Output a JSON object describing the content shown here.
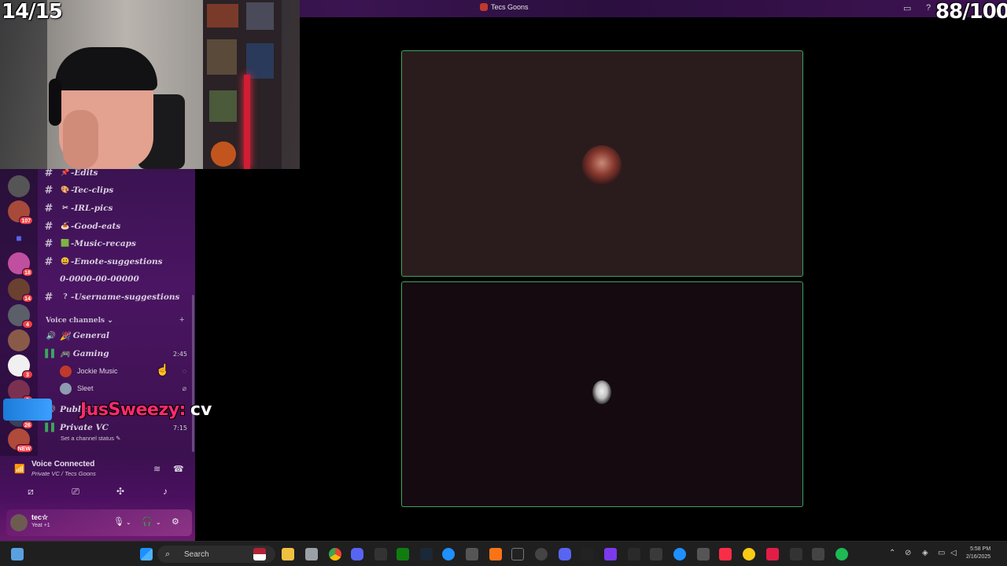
{
  "stream": {
    "left_counter": "14/15",
    "right_counter": "88/100",
    "chat_overlay": {
      "username": "JusSweezy:",
      "message": "cv"
    }
  },
  "window": {
    "title": "Tecs Goons"
  },
  "servers": [
    {
      "icon": "server-avatar",
      "color": "#7a5a48",
      "ping": ""
    },
    {
      "icon": "server-avatar",
      "color": "#a84a3a",
      "ping": "107"
    },
    {
      "icon": "folder-icon",
      "color": "#5865f2",
      "ping": ""
    },
    {
      "icon": "server-avatar",
      "color": "#c04fa0",
      "ping": "18"
    },
    {
      "icon": "server-avatar",
      "color": "#6a4030",
      "ping": "14"
    },
    {
      "icon": "server-avatar",
      "color": "#5a5f6a",
      "ping": "4"
    },
    {
      "icon": "server-avatar",
      "color": "#8a5a48",
      "ping": ""
    },
    {
      "icon": "server-avatar",
      "color": "#f0f0f0",
      "ping": "3"
    },
    {
      "icon": "server-avatar",
      "color": "#7a3050",
      "ping": "8"
    },
    {
      "icon": "server-avatar",
      "color": "#3a3f5a",
      "ping": "26"
    },
    {
      "icon": "server-avatar",
      "color": "#b04a3a",
      "ping": "NEW"
    }
  ],
  "text_channels": [
    {
      "emoji": "📌",
      "name": "-Edits"
    },
    {
      "emoji": "🎨",
      "name": "-Tec-clips"
    },
    {
      "emoji": "✂",
      "name": "-IRL-pics"
    },
    {
      "emoji": "🍝",
      "name": "-Good-eats"
    },
    {
      "emoji": "🟩",
      "name": "-Music-recaps"
    },
    {
      "emoji": "😃",
      "name": "-Emote-suggestions"
    },
    {
      "emoji": "",
      "name": "0-0000-00-00000"
    },
    {
      "emoji": "?",
      "name": "-Username-suggestions"
    }
  ],
  "voice_category": {
    "label": "Voice channels",
    "chevron": "⌄",
    "add": "+"
  },
  "voice_channels": {
    "general": {
      "emoji": "🎉",
      "name": "General"
    },
    "gaming": {
      "emoji": "🎮",
      "name": "Gaming",
      "time": "2:45"
    },
    "gaming_users": [
      {
        "name": "Jockie Music",
        "color": "#c0392b"
      },
      {
        "name": "Sleet",
        "color": "#8f9bb0"
      }
    ],
    "public": {
      "name": "Public VC"
    },
    "private": {
      "name": "Private VC",
      "time": "7:15",
      "status": "Set a channel status"
    }
  },
  "voice_panel": {
    "title": "Voice Connected",
    "subtitle": "Private VC / Tecs Goons"
  },
  "user": {
    "name": "tec☆",
    "status": "Yeat +1"
  },
  "taskbar": {
    "search": "Search",
    "time": "5:58 PM",
    "date": "2/16/2025"
  },
  "colors": {
    "speaking_border": "#3ba55d",
    "tile_top": "#2a1c1c",
    "tile_bottom": "#140a10"
  }
}
